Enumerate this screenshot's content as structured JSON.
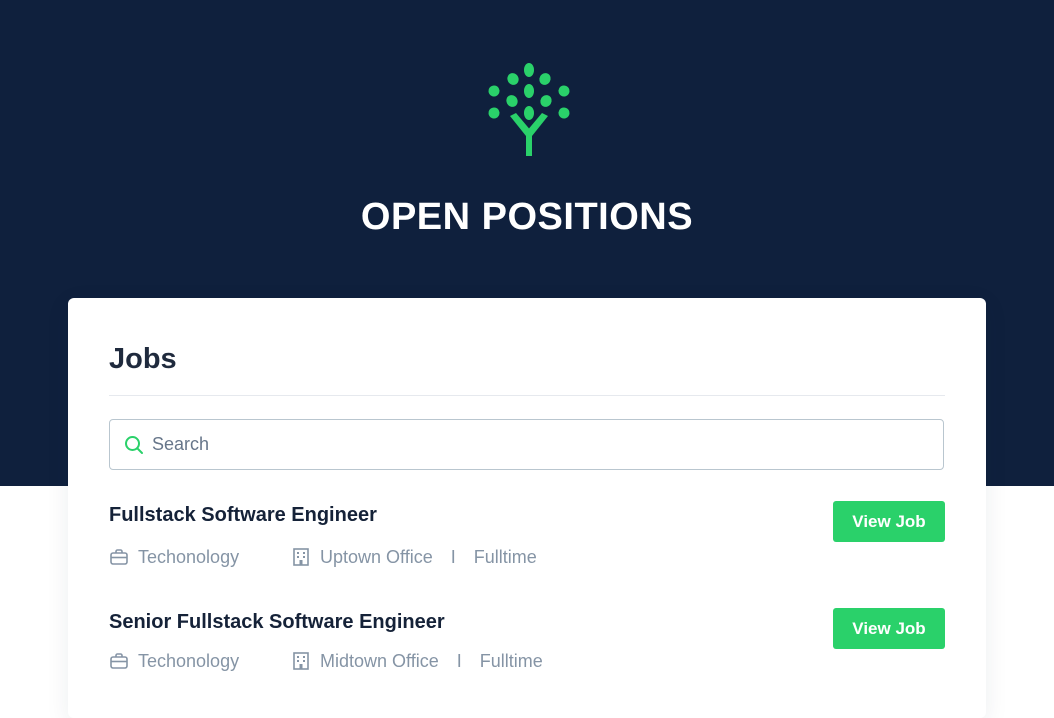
{
  "hero": {
    "title": "OPEN POSITIONS",
    "logo_icon": "tree-icon",
    "background": "#0f203d",
    "accent": "#2ad16a"
  },
  "jobs_card": {
    "title": "Jobs",
    "search": {
      "placeholder": "Search",
      "value": "",
      "icon": "search-icon"
    },
    "button_label": "View Job",
    "items": [
      {
        "title": "Fullstack Software Engineer",
        "department": "Techonology",
        "location": "Uptown Office",
        "separator": "I",
        "type": "Fulltime"
      },
      {
        "title": "Senior Fullstack Software Engineer",
        "department": "Techonology",
        "location": "Midtown Office",
        "separator": "I",
        "type": "Fulltime"
      }
    ]
  }
}
